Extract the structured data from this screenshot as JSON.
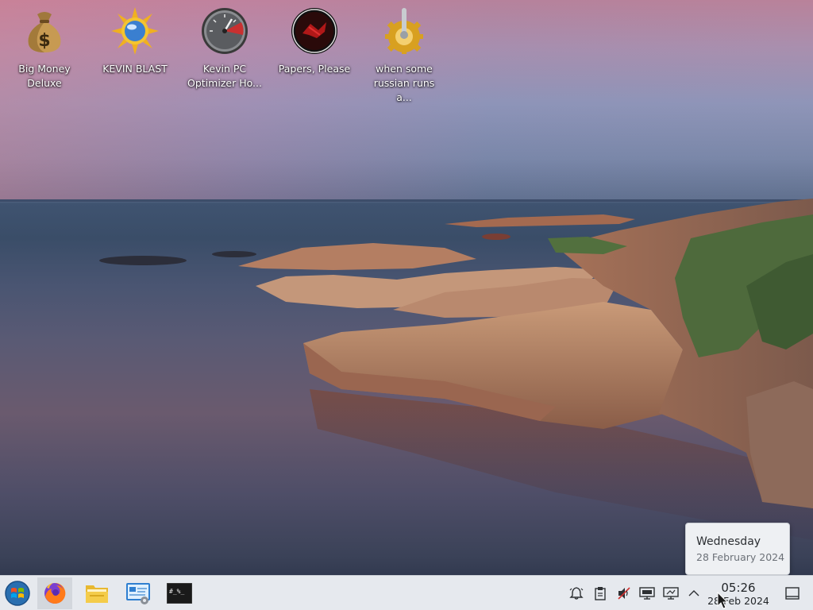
{
  "desktop": {
    "icons": [
      {
        "label": "Big Money\nDeluxe",
        "icon": "money-bag-icon"
      },
      {
        "label": "KEVIN BLAST",
        "icon": "sun-globe-icon"
      },
      {
        "label": "Kevin PC\nOptimizer Ho...",
        "icon": "speedometer-icon"
      },
      {
        "label": "Papers, Please",
        "icon": "papers-please-emblem-icon"
      },
      {
        "label": "when some\nrussian runs a...",
        "icon": "gear-joystick-icon"
      }
    ]
  },
  "tooltip": {
    "day_of_week": "Wednesday",
    "full_date": "28 February 2024"
  },
  "taskbar": {
    "launchers": [
      {
        "name": "start-menu-icon"
      },
      {
        "name": "firefox-icon"
      },
      {
        "name": "file-manager-icon"
      },
      {
        "name": "system-settings-icon"
      },
      {
        "name": "terminal-icon"
      }
    ],
    "tray": [
      {
        "name": "notifications-bell-icon"
      },
      {
        "name": "clipboard-icon"
      },
      {
        "name": "volume-muted-icon"
      },
      {
        "name": "display-icon"
      },
      {
        "name": "network-icon"
      },
      {
        "name": "chevron-up-icon"
      }
    ],
    "clock": {
      "time": "05:26",
      "date": "28 Feb 2024"
    }
  },
  "colors": {
    "taskbar_bg": "#e6e9ee",
    "tooltip_bg": "#eef0f3",
    "active_task_bg": "#d3d7dd"
  }
}
